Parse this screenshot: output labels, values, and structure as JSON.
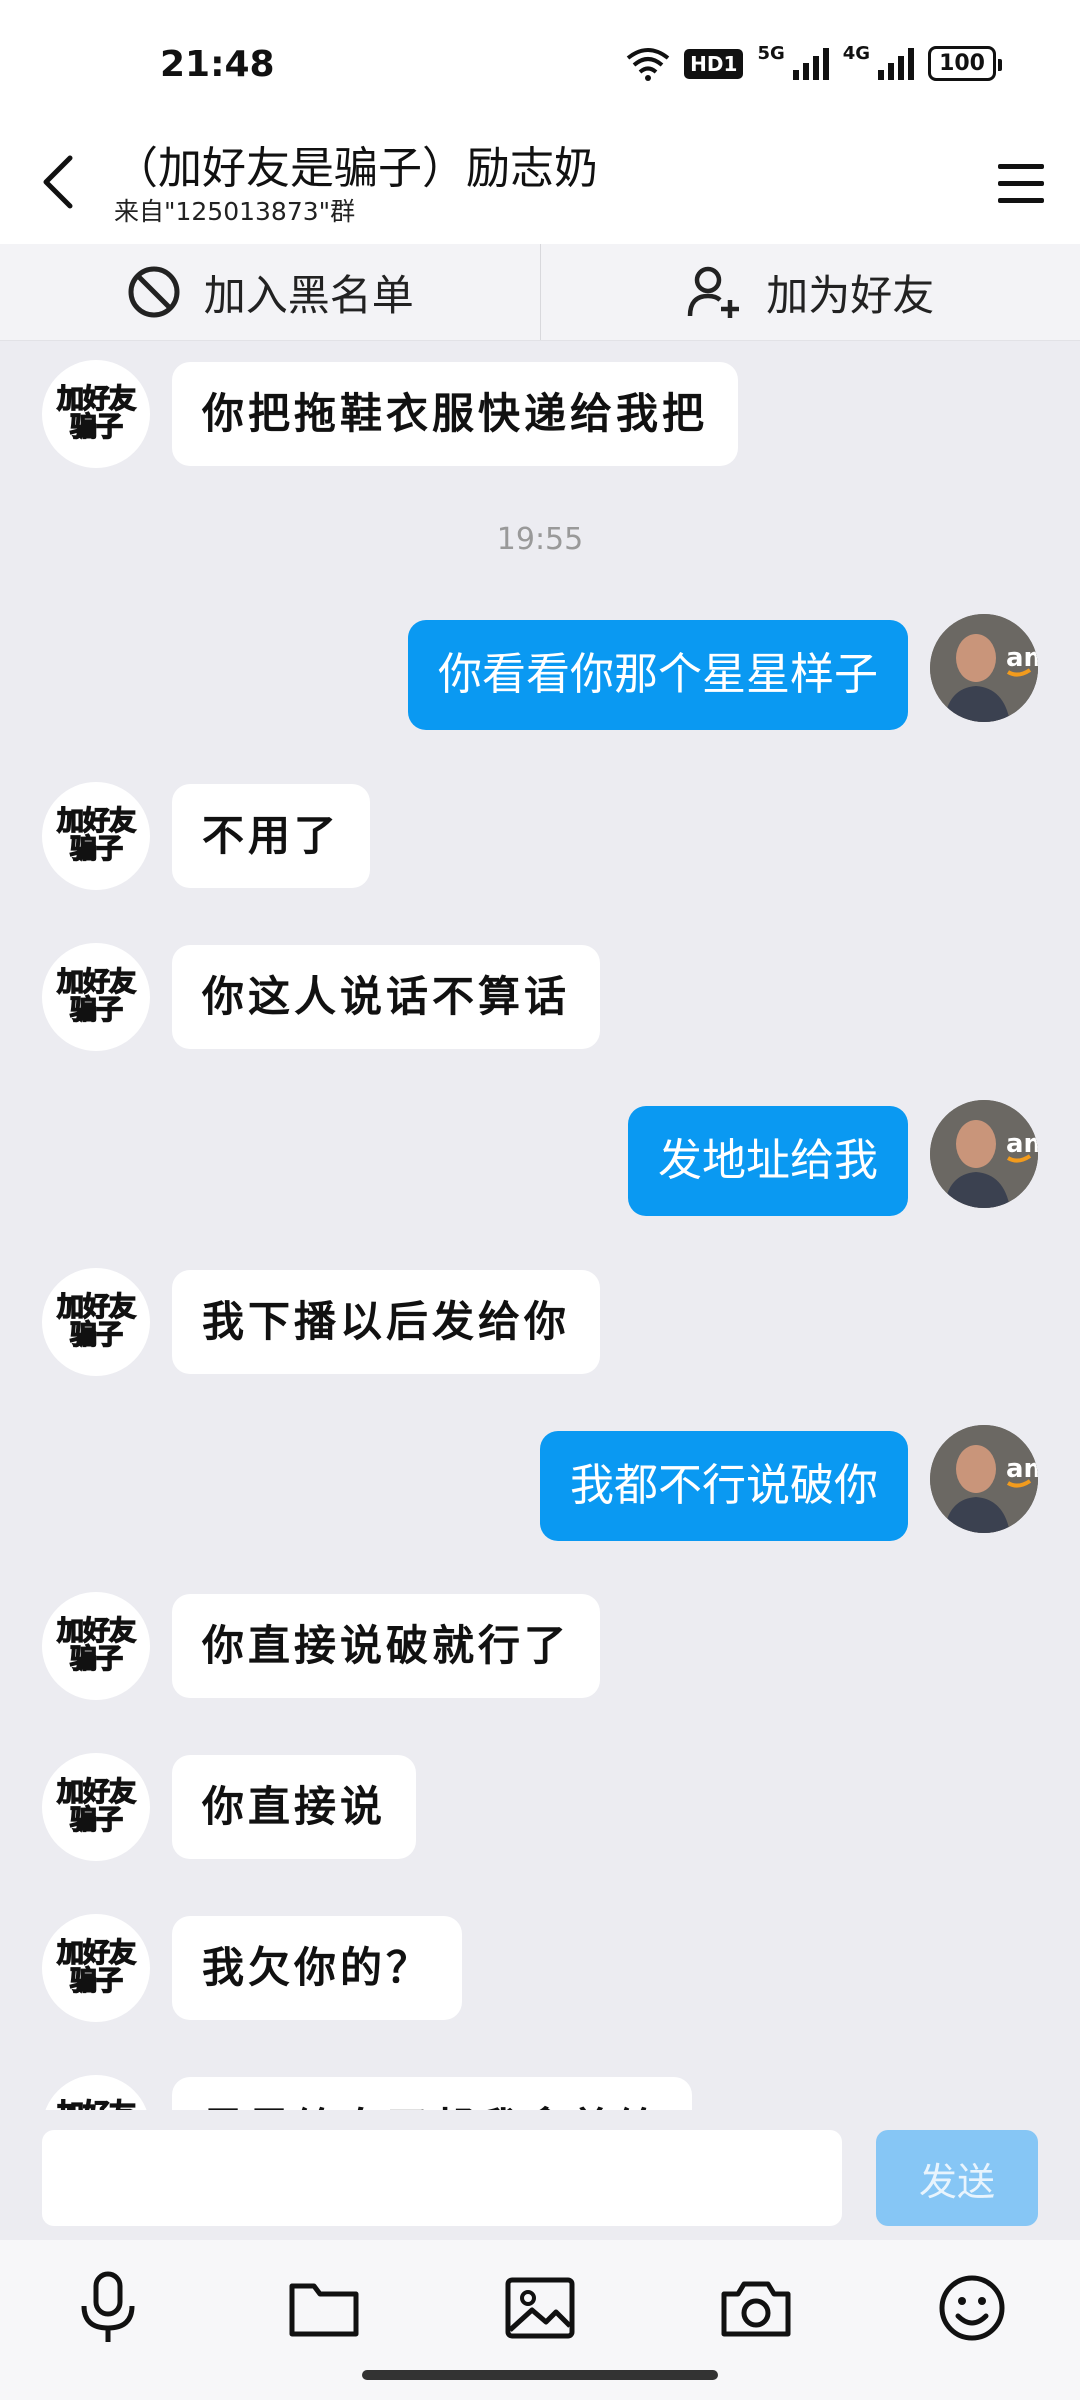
{
  "status_bar": {
    "time": "21:48",
    "hd": "HD1",
    "net1": "5G",
    "net2": "4G",
    "battery": "100"
  },
  "header": {
    "title": "（加好友是骗子）励志奶",
    "subtitle": "来自\"125013873\"群"
  },
  "actions": {
    "blacklist_label": "加入黑名单",
    "add_friend_label": "加为好友"
  },
  "contact_avatar_text": [
    "加好友",
    "骗子"
  ],
  "messages": [
    {
      "side": "in",
      "text": "你把拖鞋衣服快递给我把"
    },
    {
      "side": "time",
      "text": "19:55"
    },
    {
      "side": "out",
      "text": "你看看你那个星星样子"
    },
    {
      "side": "in",
      "text": "不用了"
    },
    {
      "side": "in",
      "text": "你这人说话不算话"
    },
    {
      "side": "out",
      "text": "发地址给我"
    },
    {
      "side": "in",
      "text": "我下播以后发给你"
    },
    {
      "side": "out",
      "text": "我都不行说破你"
    },
    {
      "side": "in",
      "text": "你直接说破就行了"
    },
    {
      "side": "in",
      "text": "你直接说"
    },
    {
      "side": "in",
      "text": "我欠你的？"
    },
    {
      "side": "in",
      "text": "星星给自买帮我拿着给"
    }
  ],
  "input": {
    "value": "",
    "placeholder": ""
  },
  "send_label": "发送",
  "toolbar_icons": [
    "microphone-icon",
    "folder-icon",
    "image-icon",
    "camera-icon",
    "emoji-icon"
  ],
  "colors": {
    "outgoing_bubble": "#0A99F2",
    "incoming_bubble": "#FFFFFF",
    "background": "#ECECF1",
    "send_disabled": "#86C6F5"
  }
}
